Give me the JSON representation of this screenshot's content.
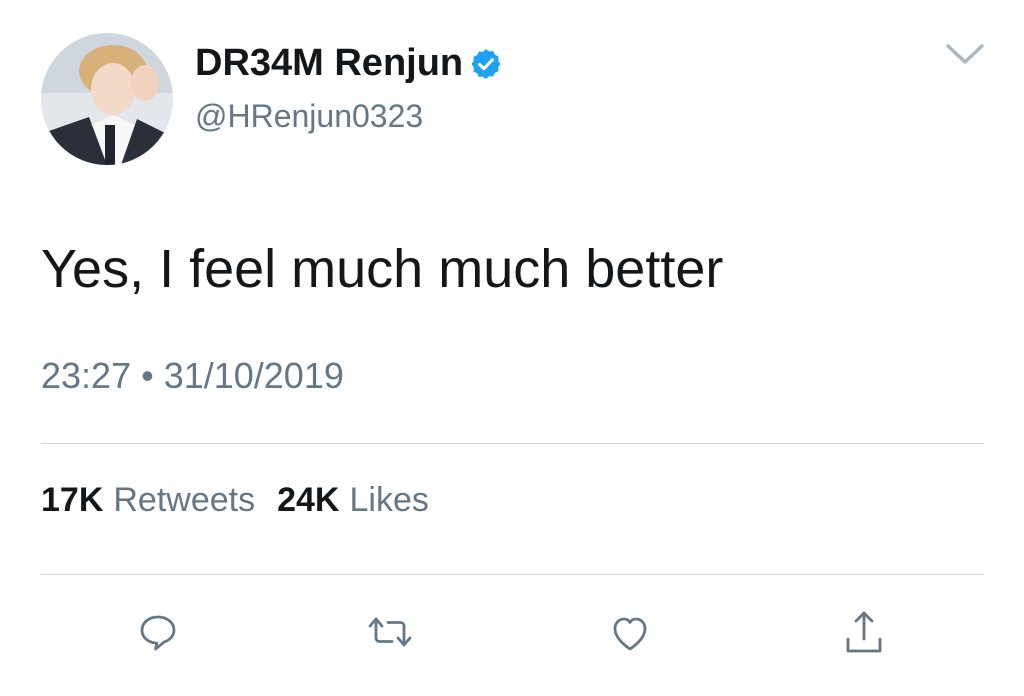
{
  "tweet": {
    "display_name": "DR34M Renjun",
    "handle": "@HRenjun0323",
    "verified": true,
    "text": "Yes, I feel much much better",
    "time": "23:27",
    "separator": "•",
    "date": "31/10/2019",
    "timestamp": "23:27 • 31/10/2019"
  },
  "stats": {
    "retweets_count": "17K",
    "retweets_label": "Retweets",
    "likes_count": "24K",
    "likes_label": "Likes"
  },
  "icons": {
    "avatar": "profile-photo",
    "verified": "verified-badge-icon",
    "caret": "chevron-down-icon",
    "reply": "reply-icon",
    "retweet": "retweet-icon",
    "like": "heart-icon",
    "share": "share-icon"
  },
  "colors": {
    "text_primary": "#14171a",
    "text_secondary": "#657786",
    "verified_blue": "#1da1f2",
    "icon_gray": "#657786",
    "divider": "#d4d8dc"
  }
}
